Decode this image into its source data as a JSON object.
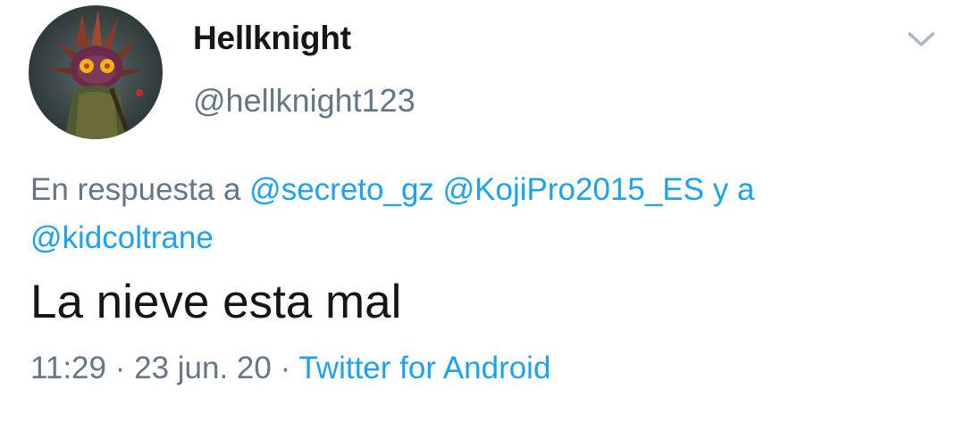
{
  "user": {
    "display_name": "Hellknight",
    "handle": "@hellknight123",
    "avatar_icon": "masked-skull-kid-avatar"
  },
  "menu": {
    "icon": "chevron-down-icon"
  },
  "reply": {
    "prefix": "En respuesta a",
    "mentions": [
      "@secreto_gz",
      "@KojiPro2015_ES",
      "@kidcoltrane"
    ],
    "conjunction": "y a"
  },
  "tweet": {
    "text": "La nieve esta mal"
  },
  "meta": {
    "time": "11:29",
    "separator": "·",
    "date": "23 jun. 20",
    "source": "Twitter for Android"
  },
  "colors": {
    "link": "#1da1f2",
    "secondary_text": "#657786",
    "primary_text": "#14171a"
  }
}
